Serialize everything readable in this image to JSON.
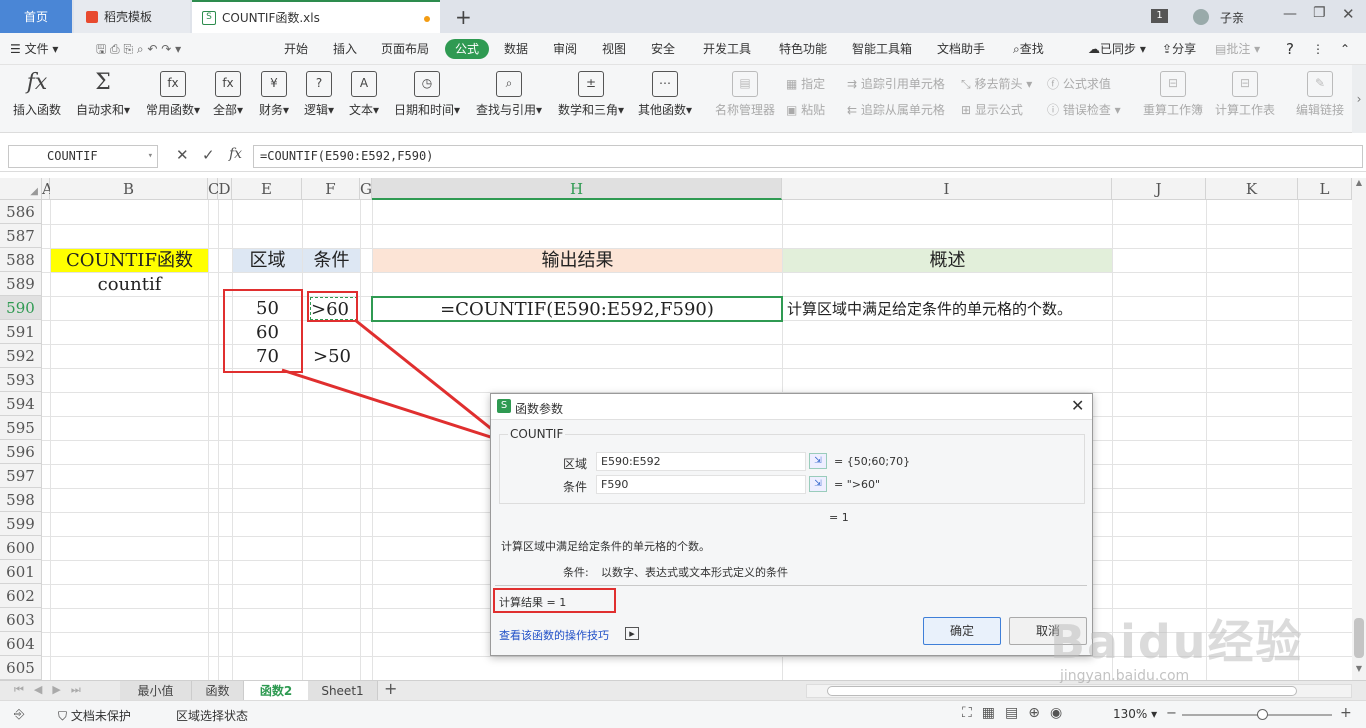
{
  "tabs": {
    "home": "首页",
    "docer": "稻壳模板",
    "file": "COUNTIF函数.xls",
    "badge": "1",
    "user": "子亲"
  },
  "menu": {
    "file": "文件",
    "items": [
      "开始",
      "插入",
      "页面布局",
      "公式",
      "数据",
      "审阅",
      "视图",
      "安全",
      "开发工具",
      "特色功能",
      "智能工具箱",
      "文档助手"
    ],
    "search": "查找",
    "synced": "已同步",
    "share": "分享",
    "comment": "批注"
  },
  "ribbon": {
    "insert_func": "插入函数",
    "autosum": "自动求和",
    "common": "常用函数",
    "all": "全部",
    "finance": "财务",
    "logic": "逻辑",
    "text": "文本",
    "datetime": "日期和时间",
    "lookup": "查找与引用",
    "math": "数学和三角",
    "other": "其他函数",
    "name_mgr": "名称管理器",
    "define": "指定",
    "paste": "粘贴",
    "trace_prec": "追踪引用单元格",
    "trace_dep": "追踪从属单元格",
    "remove_arrows": "移去箭头",
    "show_formula": "显示公式",
    "eval_formula": "公式求值",
    "error_check": "错误检查",
    "recalc_book": "重算工作簿",
    "recalc_sheet": "计算工作表",
    "edit_links": "编辑链接"
  },
  "formula_bar": {
    "name_box": "COUNTIF",
    "fx": "fx",
    "formula": "=COUNTIF(E590:E592,F590)"
  },
  "columns": [
    "A",
    "B",
    "C",
    "D",
    "E",
    "F",
    "G",
    "H",
    "I",
    "J",
    "K",
    "L"
  ],
  "rows": [
    "586",
    "587",
    "588",
    "589",
    "590",
    "591",
    "592",
    "593",
    "594",
    "595",
    "596",
    "597",
    "598",
    "599",
    "600",
    "601",
    "602",
    "603",
    "604",
    "605"
  ],
  "cells": {
    "b588": "COUNTIF函数",
    "b589": "countif",
    "e588": "区域",
    "f588": "条件",
    "h588": "输出结果",
    "i588": "概述",
    "e590": "50",
    "e591": "60",
    "e592": "70",
    "f590": ">60",
    "f592": ">50",
    "h590": "=COUNTIF(E590:E592,F590)",
    "i590": "计算区域中满足给定条件的单元格的个数。"
  },
  "dialog": {
    "title": "函数参数",
    "func": "COUNTIF",
    "arg1_label": "区域",
    "arg1_value": "E590:E592",
    "arg1_result": "= {50;60;70}",
    "arg2_label": "条件",
    "arg2_value": "F590",
    "arg2_result": "= \">60\"",
    "overall": "= 1",
    "description": "计算区域中满足给定条件的单元格的个数。",
    "param_label": "条件:",
    "param_desc": "以数字、表达式或文本形式定义的条件",
    "calc_result": "计算结果 = 1",
    "help_link": "查看该函数的操作技巧",
    "ok": "确定",
    "cancel": "取消"
  },
  "sheets": [
    "最小值",
    "函数",
    "函数2",
    "Sheet1"
  ],
  "status": {
    "protect": "文档未保护",
    "select_mode": "区域选择状态",
    "zoom": "130%"
  },
  "watermark": {
    "main": "Baidu经验",
    "sub": "jingyan.baidu.com"
  },
  "colors": {
    "accent": "#2f9a52",
    "yellow": "#ffff00",
    "peach": "#fce4d6",
    "green_header": "#e2efda",
    "blue_header": "#dde7f3",
    "red": "#e02f2f"
  }
}
